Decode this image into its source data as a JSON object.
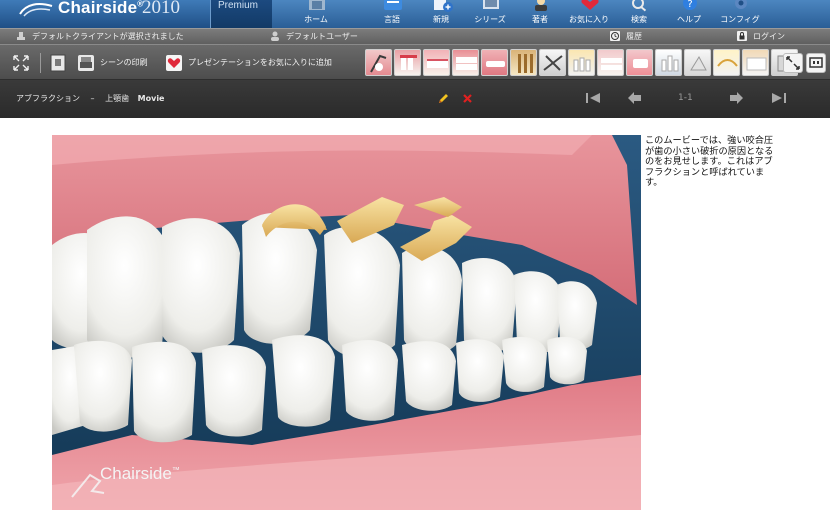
{
  "header": {
    "app_name": "Chairside",
    "trademark": "®",
    "year": "2010",
    "edition": "Premium",
    "nav": [
      {
        "label": "ホーム",
        "icon": "home-icon"
      },
      {
        "label": "言語",
        "icon": "language-icon"
      },
      {
        "label": "新規",
        "icon": "new-icon"
      },
      {
        "label": "シリーズ",
        "icon": "series-icon"
      },
      {
        "label": "著者",
        "icon": "author-icon"
      },
      {
        "label": "お気に入り",
        "icon": "favorites-icon"
      },
      {
        "label": "検索",
        "icon": "search-icon"
      },
      {
        "label": "ヘルプ",
        "icon": "help-icon"
      },
      {
        "label": "コンフィグ",
        "icon": "config-icon"
      }
    ]
  },
  "status": {
    "client": "デフォルトクライアントが選択されました",
    "user": "デフォルトユーザー",
    "history": "履歴",
    "login": "ログイン"
  },
  "toolbar": {
    "print_scene": "シーンの印刷",
    "add_favorite": "プレゼンテーションをお気に入りに追加"
  },
  "title": {
    "prefix": "アブフラクション",
    "separator": "–",
    "name": "上顎歯",
    "type": "Movie",
    "page": "1-1"
  },
  "content": {
    "description": "このムービーでは、強い咬合圧が歯の小さい破折の原因となるのをお見せします。これはアブフラクションと呼ばれています。",
    "watermark": "Chairside",
    "watermark_tm": "™"
  },
  "colors": {
    "header_blue": "#2f67a3",
    "toolbar_gray": "#5b5b5b",
    "title_dark": "#2f2f2f",
    "gum_pink": "#e79a9f",
    "edit_yellow": "#f2c320",
    "delete_red": "#e02020"
  }
}
